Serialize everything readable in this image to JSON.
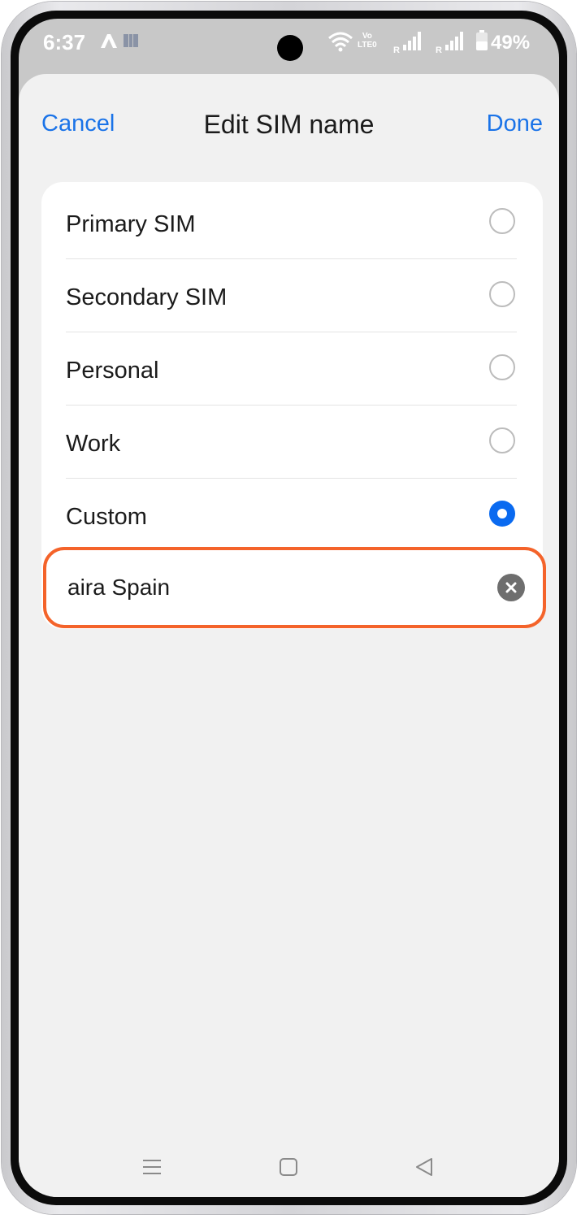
{
  "status_bar": {
    "time": "6:37",
    "volte_top": "Vo",
    "volte_bottom": "LTE0",
    "roaming_1": "R",
    "roaming_2": "R",
    "battery": "49%",
    "icons": [
      "a-app-icon",
      "wallet-icon",
      "wifi-icon",
      "signal-icon",
      "signal-icon",
      "battery-icon"
    ]
  },
  "header": {
    "cancel_label": "Cancel",
    "title": "Edit SIM name",
    "done_label": "Done"
  },
  "options": [
    {
      "label": "Primary SIM",
      "selected": false
    },
    {
      "label": "Secondary SIM",
      "selected": false
    },
    {
      "label": "Personal",
      "selected": false
    },
    {
      "label": "Work",
      "selected": false
    },
    {
      "label": "Custom",
      "selected": true
    }
  ],
  "custom_input": {
    "value": "aira Spain"
  },
  "colors": {
    "accent": "#1a73e8",
    "radio_selected": "#0a6af0",
    "highlight_border": "#f4632a",
    "sheet_background": "#f1f1f1"
  },
  "navigation": {
    "icons": [
      "recents-icon",
      "home-icon",
      "back-icon"
    ]
  }
}
